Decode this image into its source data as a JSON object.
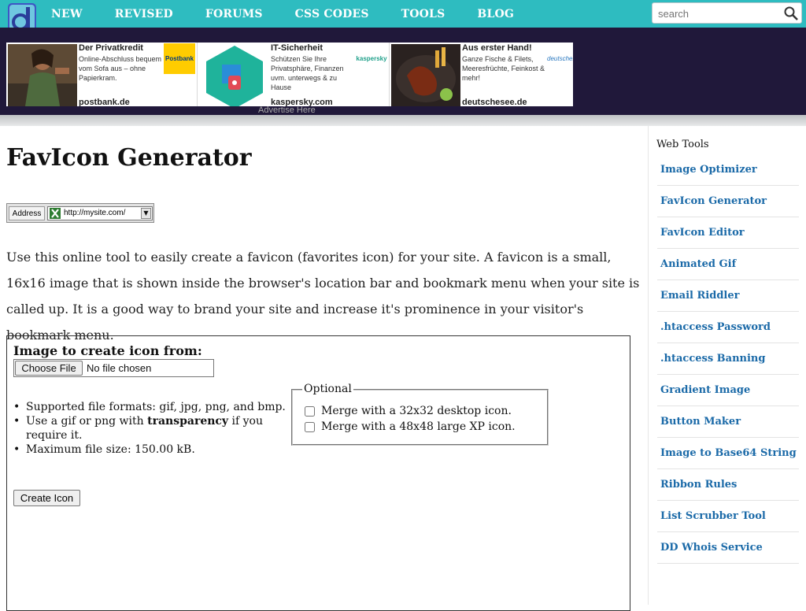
{
  "nav": {
    "items": [
      "NEW",
      "REVISED",
      "FORUMS",
      "CSS CODES",
      "TOOLS",
      "BLOG"
    ],
    "search_placeholder": "search"
  },
  "ads": {
    "items": [
      {
        "title": "Der Privatkredit",
        "desc": "Online-Abschluss bequem vom Sofa aus – ohne Papierkram.",
        "domain": "postbank.de",
        "brand": "Postbank"
      },
      {
        "title": "IT-Sicherheit",
        "desc": "Schützen Sie Ihre Privatsphäre, Finanzen uvm. unterwegs & zu Hause",
        "domain": "kaspersky.com",
        "brand": "kaspersky"
      },
      {
        "title": "Aus erster Hand!",
        "desc": "Ganze Fische & Filets, Meeresfrüchte, Feinkost & mehr!",
        "domain": "deutschesee.de",
        "brand": "deutschesee"
      }
    ],
    "advertise_label": "Advertise Here"
  },
  "main": {
    "title": "FavIcon Generator",
    "address_label": "Address",
    "address_url": "http://mysite.com/",
    "intro": "Use this online tool to easily create a favicon (favorites icon) for your site. A favicon is a small, 16x16 image that is shown inside the browser's location bar and bookmark menu when your site is called up. It is a good way to brand your site and increase it's prominence in your visitor's bookmark menu.",
    "form": {
      "image_label": "Image to create icon from:",
      "choose_file": "Choose File",
      "no_file": "No file chosen",
      "tip1": "Supported file formats: gif, jpg, png, and bmp.",
      "tip2_pre": "Use a gif or png with ",
      "tip2_bold": "transparency",
      "tip2_post": " if you require it.",
      "tip3": "Maximum file size: 150.00 kB.",
      "optional_legend": "Optional",
      "merge32": "Merge with a 32x32 desktop icon.",
      "merge48": "Merge with a 48x48 large XP icon.",
      "create_button": "Create Icon"
    }
  },
  "sidebar": {
    "title": "Web Tools",
    "items": [
      "Image Optimizer",
      "FavIcon Generator",
      "FavIcon Editor",
      "Animated Gif",
      "Email Riddler",
      ".htaccess Password",
      ".htaccess Banning",
      "Gradient Image",
      "Button Maker",
      "Image to Base64 String",
      "Ribbon Rules",
      "List Scrubber Tool",
      "DD Whois Service"
    ]
  },
  "colors": {
    "topbar": "#2ebcc0",
    "adband": "#20183a",
    "link": "#1b6aa8"
  }
}
